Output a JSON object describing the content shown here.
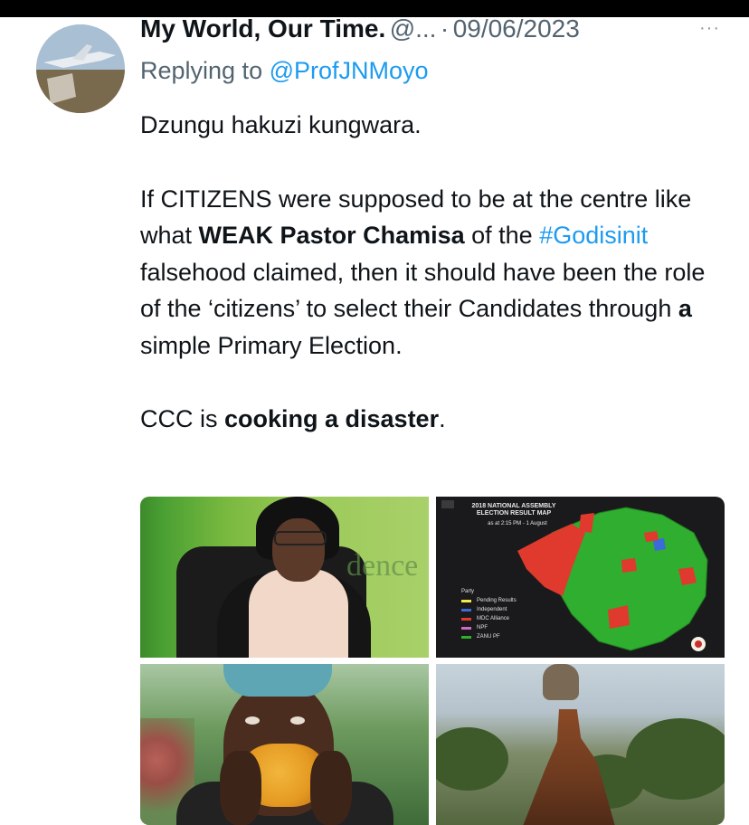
{
  "tweet": {
    "display_name": "My World, Our Time.",
    "handle": "@...",
    "separator": "·",
    "date": "09/06/2023",
    "more": "···",
    "replying_prefix": "Replying to ",
    "replying_handle": "@ProfJNMoyo",
    "para1": "Dzungu hakuzi kungwara.",
    "para2": {
      "t1": "If CITIZENS were supposed to be at the centre like what ",
      "b1": "WEAK Pastor Chamisa",
      "t2": " of the ",
      "hashtag": "#Godisinit",
      "t3": " falsehood claimed, then it should have been the role of the ‘citizens’ to select their Candidates through ",
      "b2": "a",
      "t4": " simple Primary Election."
    },
    "para3": {
      "t1": "CCC is ",
      "b1": "cooking a disaster",
      "t2": "."
    }
  },
  "media": {
    "tile1_wall_text": "dence",
    "map": {
      "title": "2018 NATIONAL ASSEMBLY ELECTION RESULT MAP",
      "subtitle": "as at 2:15 PM - 1 August",
      "legend_title": "Party",
      "legend": [
        {
          "label": "Pending Results",
          "color": "#f2e94b"
        },
        {
          "label": "Independent",
          "color": "#3a6bd8"
        },
        {
          "label": "MDC Alliance",
          "color": "#e03a2e"
        },
        {
          "label": "NPF",
          "color": "#d567c9"
        },
        {
          "label": "ZANU PF",
          "color": "#2fae2f"
        }
      ]
    }
  },
  "colors": {
    "link": "#1d9bf0",
    "secondary_text": "#536471",
    "primary_text": "#0f1419"
  }
}
